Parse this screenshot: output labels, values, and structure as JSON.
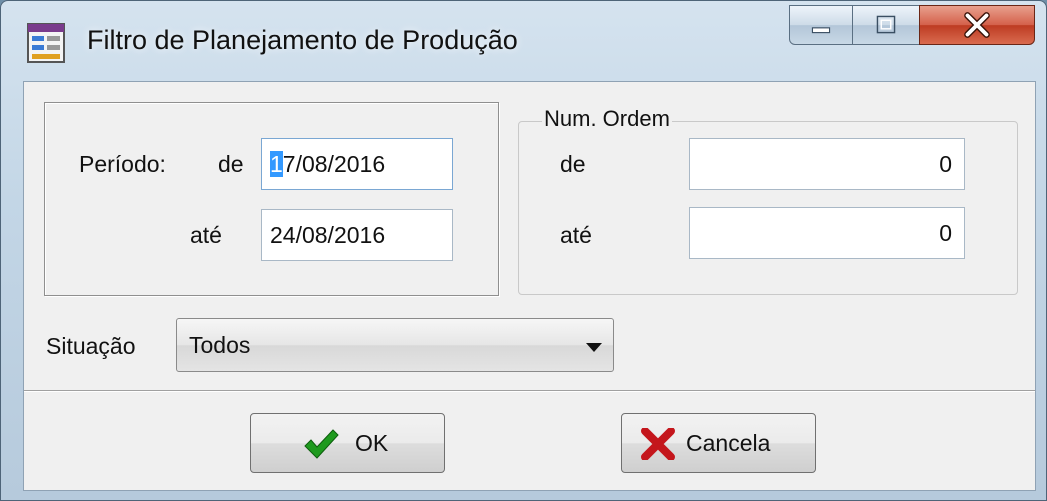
{
  "window": {
    "title": "Filtro de Planejamento de Produção"
  },
  "periodo": {
    "label": "Período:",
    "de_label": "de",
    "de_value_selected": "1",
    "de_value_rest": "7/08/2016",
    "ate_label": "até",
    "ate_value": "24/08/2016"
  },
  "num_ordem": {
    "legend": "Num. Ordem",
    "de_label": "de",
    "de_value": "0",
    "ate_label": "até",
    "ate_value": "0"
  },
  "situacao": {
    "label": "Situação",
    "selected": "Todos"
  },
  "buttons": {
    "ok_label": "OK",
    "cancel_label": "Cancela"
  },
  "colors": {
    "ok_check": "#1e9a1e",
    "cancel_x": "#c4161c",
    "selection": "#3399ff"
  },
  "icons": {
    "title": "form-icon",
    "minimize": "minimize-icon",
    "maximize": "maximize-icon",
    "close": "close-icon",
    "combo": "chevron-down-icon",
    "ok": "checkmark-icon",
    "cancel": "x-icon"
  }
}
